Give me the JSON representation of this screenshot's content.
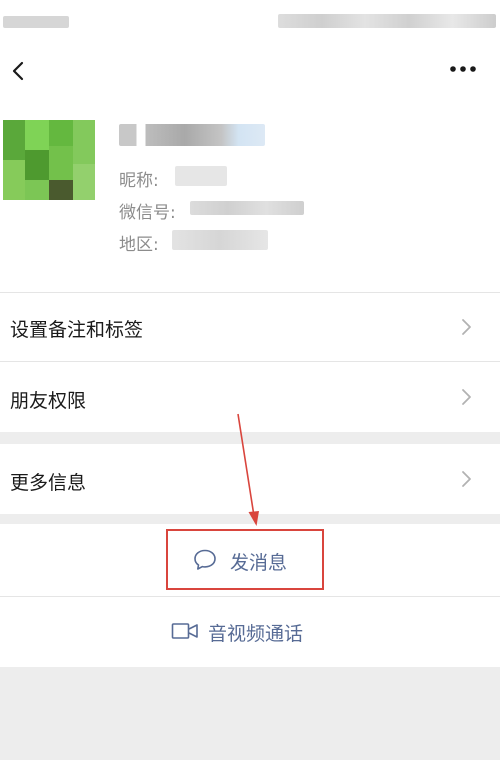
{
  "nav": {
    "back_icon": "chevron-left-icon",
    "more_icon": "more-dots-icon"
  },
  "profile": {
    "nickname_label": "昵称:",
    "wechat_id_label": "微信号:",
    "region_label": "地区:"
  },
  "rows": [
    {
      "label": "设置备注和标签",
      "icon": "chevron-right-icon"
    },
    {
      "label": "朋友权限",
      "icon": "chevron-right-icon"
    },
    {
      "label": "更多信息",
      "icon": "chevron-right-icon"
    }
  ],
  "actions": {
    "send_message": {
      "label": "发消息",
      "icon": "chat-bubble-icon"
    },
    "video_call": {
      "label": "音视频通话",
      "icon": "video-camera-icon"
    }
  },
  "colors": {
    "link_blue": "#576b95",
    "annotation_red": "#d9453d",
    "background": "#ededed"
  }
}
